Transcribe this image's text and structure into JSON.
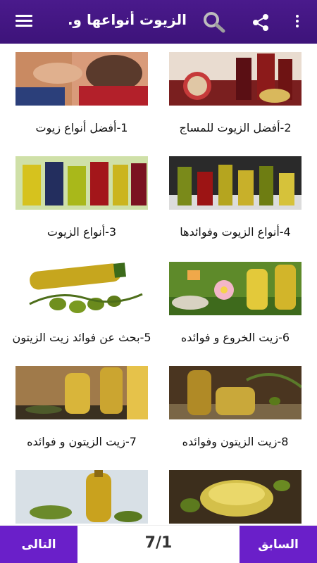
{
  "appbar": {
    "title": "الزيوت أنواعها و...",
    "icons": [
      "menu-icon",
      "search-icon",
      "share-icon",
      "more-vert-icon"
    ]
  },
  "items": [
    {
      "label": "2-أفضل الزيوت للمساج"
    },
    {
      "label": "1-أفضل أنواع زيوت"
    },
    {
      "label": "4-أنواع الزيوت وفوائدها"
    },
    {
      "label": "3-أنواع الزيوت"
    },
    {
      "label": "6-زيت الخروع و فوائده"
    },
    {
      "label": "5-بحث عن فوائد زيت الزيتون"
    },
    {
      "label": "8-زيت الزيتون وفوائده"
    },
    {
      "label": "7-زيت الزيتون و فوائده"
    },
    {
      "label": ""
    },
    {
      "label": ""
    }
  ],
  "footer": {
    "next_label": "التالى",
    "prev_label": "السابق",
    "page_indicator": "7/1"
  },
  "colors": {
    "appbar": "#4a1a8c",
    "buttons": "#6a1fc9"
  }
}
